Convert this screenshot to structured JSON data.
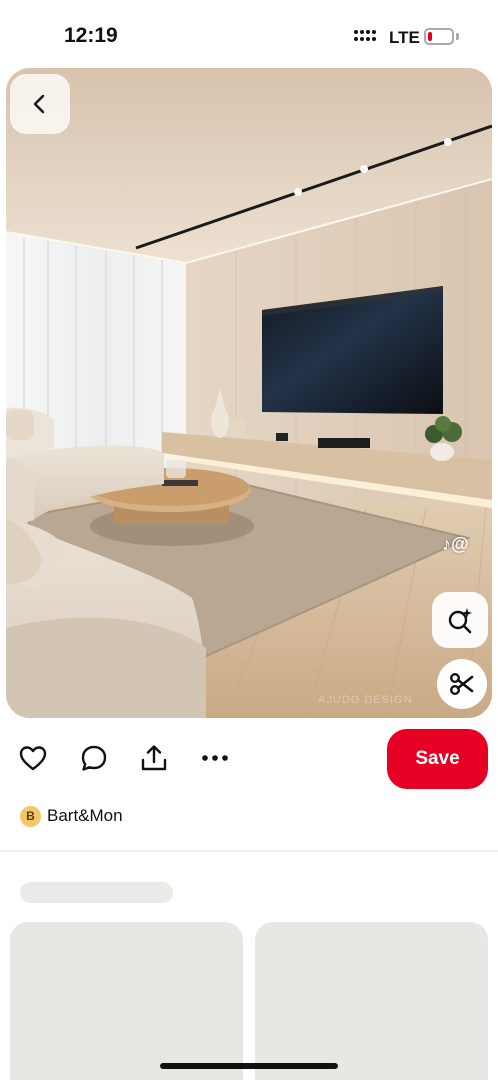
{
  "status_bar": {
    "time": "12:19",
    "network": "LTE",
    "battery_level": 0.1,
    "battery_color": "#e60023"
  },
  "pin": {
    "image_icons": {
      "back": "chevron-left-icon",
      "tiktok": "tiktok-icon",
      "visual_search": "sparkle-search-icon",
      "cutout": "scissors-icon"
    },
    "tiktok_handle_symbol": "@",
    "watermark": "AJUDO DESIGN"
  },
  "actions": {
    "icons": [
      "heart-icon",
      "comment-icon",
      "share-icon",
      "more-icon"
    ],
    "save_label": "Save",
    "save_color": "#e60023"
  },
  "author": {
    "initial": "B",
    "name": "Bart&Mon",
    "avatar_color": "#f4c56b"
  }
}
